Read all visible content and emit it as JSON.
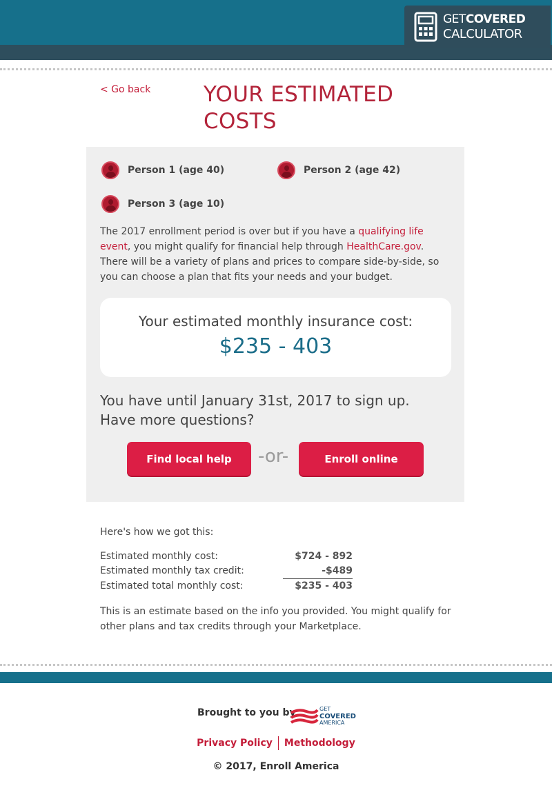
{
  "header": {
    "logo_line1_light": "GET",
    "logo_line1_bold": "COVERED",
    "logo_line2": "CALCULATOR"
  },
  "nav": {
    "go_back": "< Go back"
  },
  "page_title": "YOUR ESTIMATED COSTS",
  "people": [
    {
      "label": "Person 1 (age 40)"
    },
    {
      "label": "Person 2 (age 42)"
    },
    {
      "label": "Person 3 (age 10)"
    }
  ],
  "info": {
    "part1": "The 2017 enrollment period is over but if you have a ",
    "link_qle": "qualifying life event",
    "part2": ", you might qualify for financial help through ",
    "link_healthcare": "HealthCare.gov",
    "part3": ". There will be a variety of plans and prices to compare side-by-side, so you can choose a plan that fits your needs and your budget."
  },
  "estimate": {
    "label": "Your estimated monthly insurance cost:",
    "value": "$235 - 403"
  },
  "deadline_text": "You have until January 31st, 2017 to sign up. Have more questions?",
  "actions": {
    "local_help": "Find local help",
    "or": "-or-",
    "enroll": "Enroll online"
  },
  "breakdown": {
    "heading": "Here's how we got this:",
    "rows": [
      {
        "label": "Estimated monthly cost:",
        "value": "$724 - 892"
      },
      {
        "label": "Estimated monthly tax credit:",
        "value": "-$489"
      },
      {
        "label": "Estimated total monthly cost:",
        "value": "$235 - 403"
      }
    ],
    "disclaimer": "This is an estimate based on the info you provided. You might qualify for other plans and tax credits through your Marketplace."
  },
  "footer": {
    "brought_by": "Brought to you by",
    "gca_line1": "GET",
    "gca_line2": "COVERED",
    "gca_line3": "AMERICA",
    "privacy": "Privacy Policy",
    "methodology": "Methodology",
    "copyright": "© 2017, Enroll America"
  },
  "colors": {
    "header_teal": "#16708b",
    "header_dark": "#2e4e5d",
    "accent_red": "#c41e3a",
    "button_red": "#dc1e45",
    "cost_blue": "#1b6d89",
    "panel_grey": "#efefef"
  }
}
